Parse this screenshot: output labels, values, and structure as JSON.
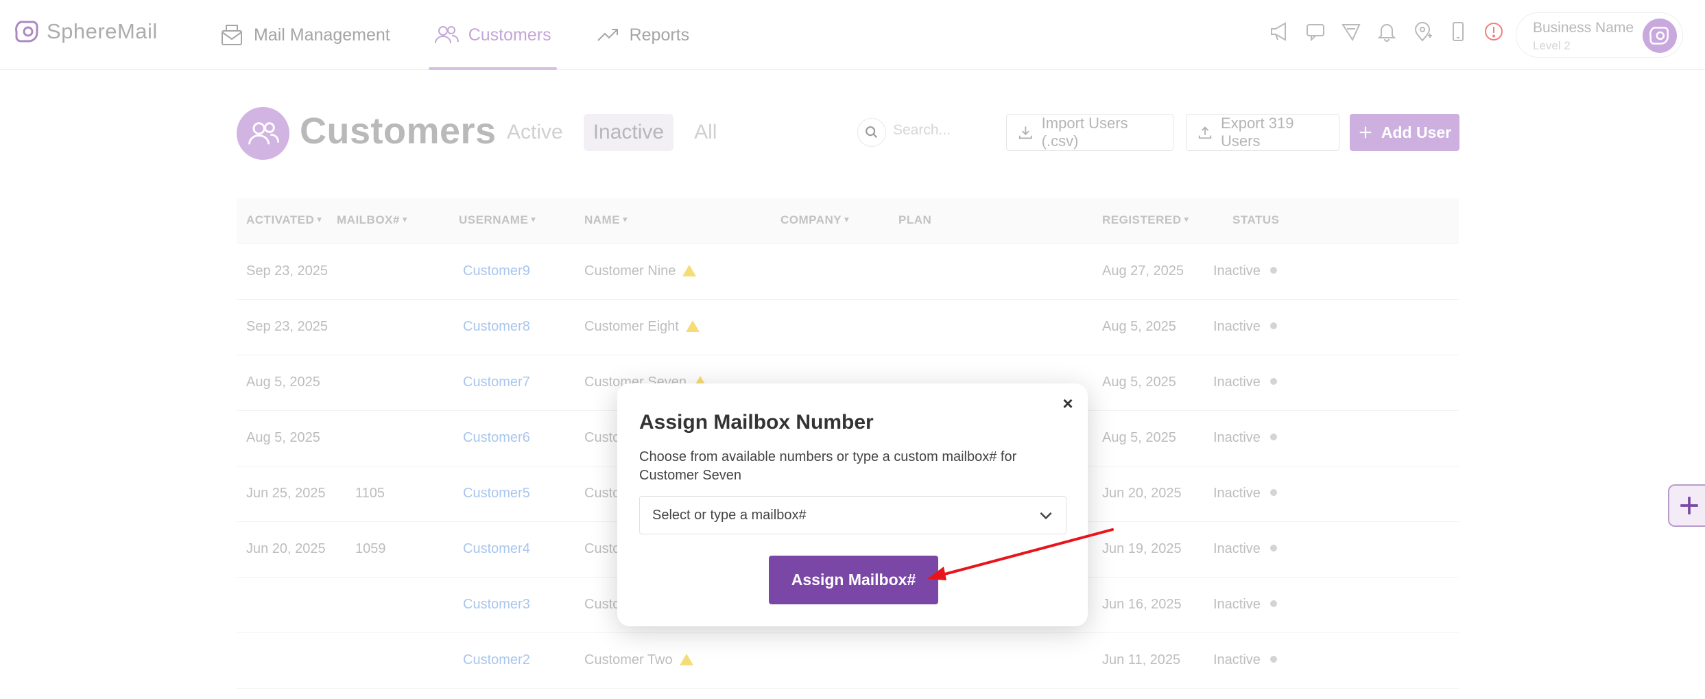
{
  "header": {
    "logo_text": "SphereMail",
    "nav": [
      {
        "label": "Mail Management",
        "icon": "mail-icon"
      },
      {
        "label": "Customers",
        "icon": "users-icon"
      },
      {
        "label": "Reports",
        "icon": "trend-icon"
      }
    ],
    "profile": {
      "name": "Business Name",
      "level": "Level 2"
    }
  },
  "page": {
    "title": "Customers",
    "filters": [
      "Active",
      "Inactive",
      "All"
    ],
    "active_filter": "Inactive",
    "search_placeholder": "Search...",
    "import_label": "Import Users (.csv)",
    "export_label": "Export 319 Users",
    "add_label": "Add User"
  },
  "table": {
    "columns": [
      "ACTIVATED",
      "MAILBOX#",
      "USERNAME",
      "NAME",
      "COMPANY",
      "PLAN",
      "REGISTERED",
      "STATUS"
    ],
    "rows": [
      {
        "activated": "Sep 23, 2025",
        "mailbox": "",
        "username": "Customer9",
        "name": "Customer Nine",
        "registered": "Aug 27, 2025",
        "status": "Inactive"
      },
      {
        "activated": "Sep 23, 2025",
        "mailbox": "",
        "username": "Customer8",
        "name": "Customer Eight",
        "registered": "Aug 5, 2025",
        "status": "Inactive"
      },
      {
        "activated": "Aug 5, 2025",
        "mailbox": "",
        "username": "Customer7",
        "name": "Customer Seven",
        "registered": "Aug 5, 2025",
        "status": "Inactive"
      },
      {
        "activated": "Aug 5, 2025",
        "mailbox": "",
        "username": "Customer6",
        "name": "Custo",
        "registered": "Aug 5, 2025",
        "status": "Inactive"
      },
      {
        "activated": "Jun 25, 2025",
        "mailbox": "1105",
        "username": "Customer5",
        "name": "Custo",
        "registered": "Jun 20, 2025",
        "status": "Inactive"
      },
      {
        "activated": "Jun 20, 2025",
        "mailbox": "1059",
        "username": "Customer4",
        "name": "Custo",
        "registered": "Jun 19, 2025",
        "status": "Inactive"
      },
      {
        "activated": "",
        "mailbox": "",
        "username": "Customer3",
        "name": "Custo",
        "registered": "Jun 16, 2025",
        "status": "Inactive"
      },
      {
        "activated": "",
        "mailbox": "",
        "username": "Customer2",
        "name": "Customer Two",
        "registered": "Jun 11, 2025",
        "status": "Inactive"
      }
    ]
  },
  "modal": {
    "title": "Assign Mailbox Number",
    "description": "Choose from available numbers or type a custom mailbox# for Customer Seven",
    "select_placeholder": "Select or type a mailbox#",
    "button_label": "Assign Mailbox#",
    "close_label": "×"
  },
  "colors": {
    "brand": "#7a47a6",
    "brand_light": "#c9a8de",
    "link": "#a9c6ee",
    "arrow": "#e8141b"
  }
}
